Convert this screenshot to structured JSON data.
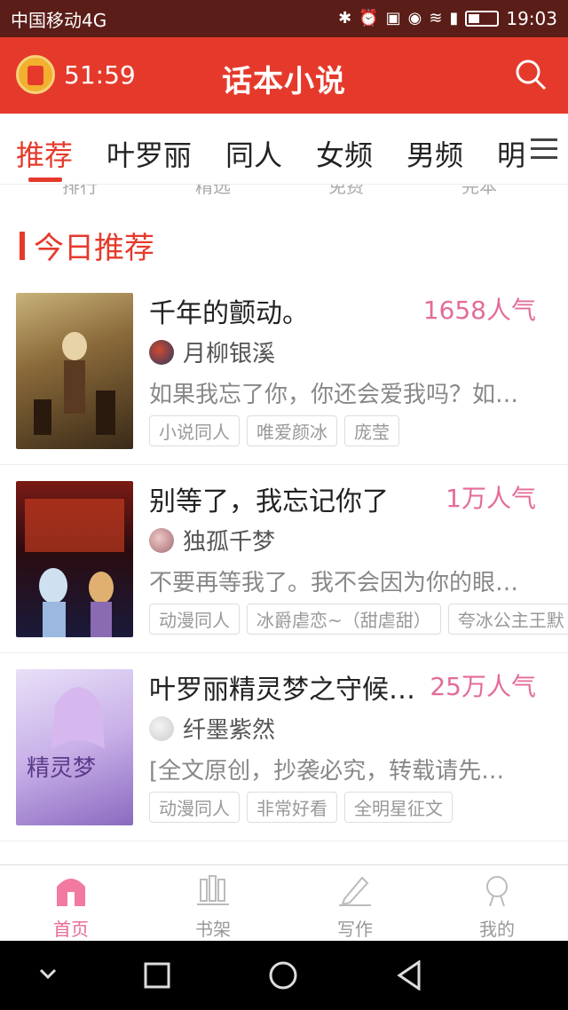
{
  "status_bar": {
    "carrier": "中国移动4G",
    "time": "19:03",
    "network": "4G"
  },
  "header": {
    "timer": "51:59",
    "title": "话本小说",
    "alarm_icon": "alarm-clock-icon",
    "search_icon": "search-icon",
    "bg_color": "#e53a2b"
  },
  "tabs": [
    "推荐",
    "叶罗丽",
    "同人",
    "女频",
    "男频",
    "明"
  ],
  "subtabs": [
    "排行",
    "精选",
    "免费",
    "完本"
  ],
  "section_title": "今日推荐",
  "books": [
    {
      "title": "千年的颤动。",
      "popularity": "1658人气",
      "author": "月柳银溪",
      "description": "如果我忘了你，你还会爱我吗？如…",
      "tags": [
        "小说同人",
        "唯爱颜冰",
        "庞莹"
      ]
    },
    {
      "title": "别等了，我忘记你了",
      "popularity": "1万人气",
      "author": "独孤千梦",
      "description": "不要再等我了。我不会因为你的眼…",
      "tags": [
        "动漫同人",
        "冰爵虐恋~（甜虐甜）",
        "夸冰公主王默"
      ]
    },
    {
      "title": "叶罗丽精灵梦之守候…",
      "popularity": "25万人气",
      "author": "纤墨紫然",
      "description": "[全文原创，抄袭必究，转载请先…",
      "tags": [
        "动漫同人",
        "非常好看",
        "全明星征文"
      ]
    }
  ],
  "bottom_nav": [
    {
      "label": "首页",
      "icon": "home-icon",
      "active": true
    },
    {
      "label": "书架",
      "icon": "bookshelf-icon",
      "active": false
    },
    {
      "label": "写作",
      "icon": "pen-icon",
      "active": false
    },
    {
      "label": "我的",
      "icon": "profile-icon",
      "active": false
    }
  ],
  "colors": {
    "accent": "#e53a2b",
    "pink": "#e46b9a"
  }
}
